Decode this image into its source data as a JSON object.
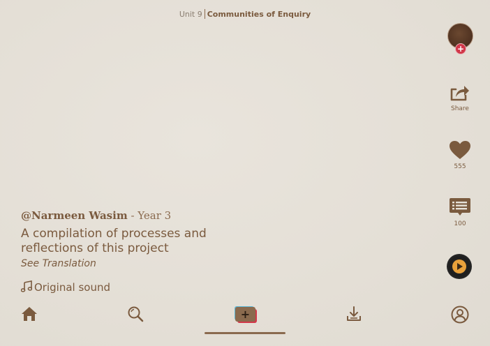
{
  "header": {
    "unit": "Unit 9",
    "topic": "Communities of Enquiry"
  },
  "rail": {
    "share_label": "Share",
    "like_count": "555",
    "comment_count": "100"
  },
  "caption": {
    "author_name": "@Narmeen Wasim",
    "author_year": " - Year 3",
    "description": "A compilation of processes and reflections of this project",
    "translate": "See Translation",
    "sound": "Original sound"
  },
  "nav": {
    "create_symbol": "+"
  },
  "colors": {
    "background": "#e6e1d8",
    "accent_brown": "#7a5a3e",
    "badge_red": "#d2384a",
    "create_blue": "#5ab7d6",
    "disc_orange": "#e9a13b"
  },
  "icons": {
    "share": "share-icon",
    "like": "heart-icon",
    "comment": "comment-icon",
    "music": "music-note-icon",
    "home": "home-icon",
    "search": "search-icon",
    "create": "create-icon",
    "download": "download-icon",
    "profile": "profile-icon"
  }
}
